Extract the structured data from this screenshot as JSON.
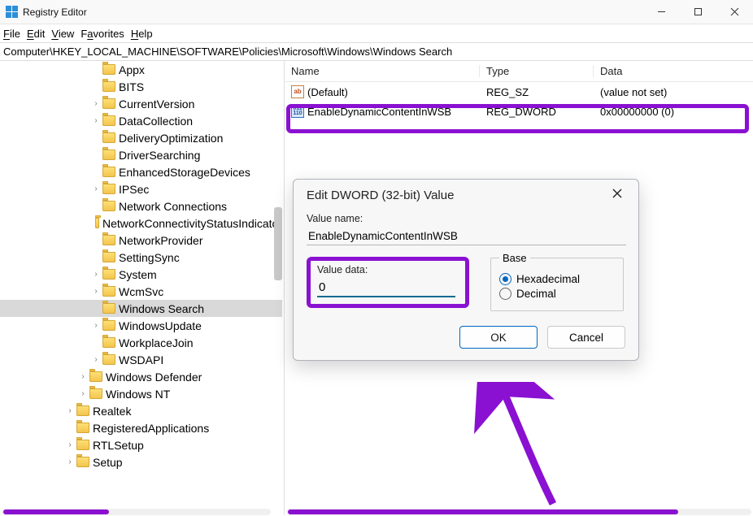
{
  "window": {
    "title": "Registry Editor"
  },
  "menubar": {
    "file": "File",
    "edit": "Edit",
    "view": "View",
    "favorites": "Favorites",
    "help": "Help"
  },
  "address": "Computer\\HKEY_LOCAL_MACHINE\\SOFTWARE\\Policies\\Microsoft\\Windows\\Windows Search",
  "tree": {
    "items": [
      {
        "indent": 7,
        "name": "Appx",
        "chev": ""
      },
      {
        "indent": 7,
        "name": "BITS",
        "chev": ""
      },
      {
        "indent": 7,
        "name": "CurrentVersion",
        "chev": "›"
      },
      {
        "indent": 7,
        "name": "DataCollection",
        "chev": "›"
      },
      {
        "indent": 7,
        "name": "DeliveryOptimization",
        "chev": ""
      },
      {
        "indent": 7,
        "name": "DriverSearching",
        "chev": ""
      },
      {
        "indent": 7,
        "name": "EnhancedStorageDevices",
        "chev": ""
      },
      {
        "indent": 7,
        "name": "IPSec",
        "chev": "›"
      },
      {
        "indent": 7,
        "name": "Network Connections",
        "chev": ""
      },
      {
        "indent": 7,
        "name": "NetworkConnectivityStatusIndicator",
        "chev": ""
      },
      {
        "indent": 7,
        "name": "NetworkProvider",
        "chev": ""
      },
      {
        "indent": 7,
        "name": "SettingSync",
        "chev": ""
      },
      {
        "indent": 7,
        "name": "System",
        "chev": "›"
      },
      {
        "indent": 7,
        "name": "WcmSvc",
        "chev": "›"
      },
      {
        "indent": 7,
        "name": "Windows Search",
        "chev": "",
        "selected": true
      },
      {
        "indent": 7,
        "name": "WindowsUpdate",
        "chev": "›"
      },
      {
        "indent": 7,
        "name": "WorkplaceJoin",
        "chev": ""
      },
      {
        "indent": 7,
        "name": "WSDAPI",
        "chev": "›"
      },
      {
        "indent": 6,
        "name": "Windows Defender",
        "chev": "›"
      },
      {
        "indent": 6,
        "name": "Windows NT",
        "chev": "›"
      },
      {
        "indent": 5,
        "name": "Realtek",
        "chev": "›"
      },
      {
        "indent": 5,
        "name": "RegisteredApplications",
        "chev": ""
      },
      {
        "indent": 5,
        "name": "RTLSetup",
        "chev": "›"
      },
      {
        "indent": 5,
        "name": "Setup",
        "chev": "›"
      }
    ]
  },
  "list": {
    "headers": {
      "name": "Name",
      "type": "Type",
      "data": "Data"
    },
    "rows": [
      {
        "icon": "sz",
        "name": "(Default)",
        "type": "REG_SZ",
        "data": "(value not set)"
      },
      {
        "icon": "dw",
        "name": "EnableDynamicContentInWSB",
        "type": "REG_DWORD",
        "data": "0x00000000 (0)"
      }
    ]
  },
  "dialog": {
    "title": "Edit DWORD (32-bit) Value",
    "value_name_label": "Value name:",
    "value_name": "EnableDynamicContentInWSB",
    "value_data_label": "Value data:",
    "value_data": "0",
    "base_legend": "Base",
    "hex_label": "Hexadecimal",
    "dec_label": "Decimal",
    "ok": "OK",
    "cancel": "Cancel"
  },
  "colors": {
    "highlight": "#8A11D1",
    "accent": "#0067c0"
  }
}
